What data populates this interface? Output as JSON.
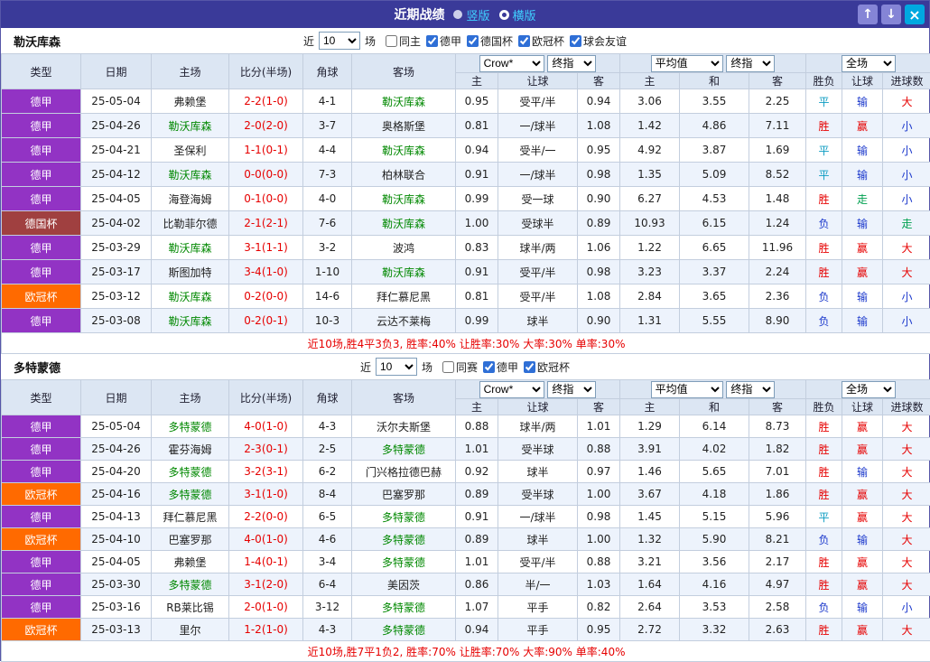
{
  "titlebar": {
    "title": "近期战绩",
    "radios": [
      {
        "label": "竖版",
        "selected": false
      },
      {
        "label": "横版",
        "selected": true
      }
    ],
    "up_glyph": "↑",
    "down_glyph": "↓",
    "close_glyph": "×",
    "bg": "#3a3a99"
  },
  "filter_labels": {
    "near": "近",
    "games": "场"
  },
  "columns": {
    "left": [
      "类型",
      "日期",
      "主场",
      "比分(半场)",
      "角球",
      "客场"
    ],
    "sub": [
      "主",
      "让球",
      "客",
      "主",
      "和",
      "客",
      "胜负",
      "让球",
      "进球数"
    ]
  },
  "league_colors": {
    "德甲": "#9233c4",
    "德国杯": "#a04040",
    "欧冠杯": "#ff6a00"
  },
  "result_colors": {
    "胜": "#e60000",
    "赢": "#e60000",
    "大": "#e60000",
    "负": "#1c39cc",
    "输": "#1c39cc",
    "小": "#1c39cc",
    "平": "#0d9cc2",
    "走": "#00a050"
  },
  "team_color": "#008800",
  "score_color": "#e60000",
  "sections": [
    {
      "team": "勒沃库森",
      "filter": {
        "count": "10",
        "checkboxes": [
          {
            "label": "同主",
            "checked": false
          },
          {
            "label": "德甲",
            "checked": true
          },
          {
            "label": "德国杯",
            "checked": true
          },
          {
            "label": "欧冠杯",
            "checked": true
          },
          {
            "label": "球会友谊",
            "checked": true
          }
        ]
      },
      "selects": {
        "odds_company": "Crow*",
        "odds_time": "终指",
        "avg": "平均值",
        "avg_time": "终指",
        "scope": "全场"
      },
      "rows": [
        {
          "league": "德甲",
          "date": "25-05-04",
          "home": "弗赖堡",
          "homeTeam": false,
          "score": "2-2(1-0)",
          "corner": "4-1",
          "away": "勒沃库森",
          "awayTeam": true,
          "odds": [
            "0.95",
            "受平/半",
            "0.94"
          ],
          "euro": [
            "3.06",
            "3.55",
            "2.25"
          ],
          "res": [
            "平",
            "输",
            "大"
          ]
        },
        {
          "league": "德甲",
          "date": "25-04-26",
          "home": "勒沃库森",
          "homeTeam": true,
          "score": "2-0(2-0)",
          "corner": "3-7",
          "away": "奥格斯堡",
          "awayTeam": false,
          "odds": [
            "0.81",
            "一/球半",
            "1.08"
          ],
          "euro": [
            "1.42",
            "4.86",
            "7.11"
          ],
          "res": [
            "胜",
            "赢",
            "小"
          ]
        },
        {
          "league": "德甲",
          "date": "25-04-21",
          "home": "圣保利",
          "homeTeam": false,
          "score": "1-1(0-1)",
          "corner": "4-4",
          "away": "勒沃库森",
          "awayTeam": true,
          "odds": [
            "0.94",
            "受半/一",
            "0.95"
          ],
          "euro": [
            "4.92",
            "3.87",
            "1.69"
          ],
          "res": [
            "平",
            "输",
            "小"
          ]
        },
        {
          "league": "德甲",
          "date": "25-04-12",
          "home": "勒沃库森",
          "homeTeam": true,
          "score": "0-0(0-0)",
          "corner": "7-3",
          "away": "柏林联合",
          "awayTeam": false,
          "odds": [
            "0.91",
            "一/球半",
            "0.98"
          ],
          "euro": [
            "1.35",
            "5.09",
            "8.52"
          ],
          "res": [
            "平",
            "输",
            "小"
          ]
        },
        {
          "league": "德甲",
          "date": "25-04-05",
          "home": "海登海姆",
          "homeTeam": false,
          "score": "0-1(0-0)",
          "corner": "4-0",
          "away": "勒沃库森",
          "awayTeam": true,
          "odds": [
            "0.99",
            "受一球",
            "0.90"
          ],
          "euro": [
            "6.27",
            "4.53",
            "1.48"
          ],
          "res": [
            "胜",
            "走",
            "小"
          ]
        },
        {
          "league": "德国杯",
          "date": "25-04-02",
          "home": "比勒菲尔德",
          "homeTeam": false,
          "score": "2-1(2-1)",
          "corner": "7-6",
          "away": "勒沃库森",
          "awayTeam": true,
          "odds": [
            "1.00",
            "受球半",
            "0.89"
          ],
          "euro": [
            "10.93",
            "6.15",
            "1.24"
          ],
          "res": [
            "负",
            "输",
            "走"
          ]
        },
        {
          "league": "德甲",
          "date": "25-03-29",
          "home": "勒沃库森",
          "homeTeam": true,
          "score": "3-1(1-1)",
          "corner": "3-2",
          "away": "波鸿",
          "awayTeam": false,
          "odds": [
            "0.83",
            "球半/两",
            "1.06"
          ],
          "euro": [
            "1.22",
            "6.65",
            "11.96"
          ],
          "res": [
            "胜",
            "赢",
            "大"
          ]
        },
        {
          "league": "德甲",
          "date": "25-03-17",
          "home": "斯图加特",
          "homeTeam": false,
          "score": "3-4(1-0)",
          "corner": "1-10",
          "away": "勒沃库森",
          "awayTeam": true,
          "odds": [
            "0.91",
            "受平/半",
            "0.98"
          ],
          "euro": [
            "3.23",
            "3.37",
            "2.24"
          ],
          "res": [
            "胜",
            "赢",
            "大"
          ]
        },
        {
          "league": "欧冠杯",
          "date": "25-03-12",
          "home": "勒沃库森",
          "homeTeam": true,
          "score": "0-2(0-0)",
          "corner": "14-6",
          "away": "拜仁慕尼黑",
          "awayTeam": false,
          "odds": [
            "0.81",
            "受平/半",
            "1.08"
          ],
          "euro": [
            "2.84",
            "3.65",
            "2.36"
          ],
          "res": [
            "负",
            "输",
            "小"
          ]
        },
        {
          "league": "德甲",
          "date": "25-03-08",
          "home": "勒沃库森",
          "homeTeam": true,
          "score": "0-2(0-1)",
          "corner": "10-3",
          "away": "云达不莱梅",
          "awayTeam": false,
          "odds": [
            "0.99",
            "球半",
            "0.90"
          ],
          "euro": [
            "1.31",
            "5.55",
            "8.90"
          ],
          "res": [
            "负",
            "输",
            "小"
          ]
        }
      ],
      "summary": "近10场,胜4平3负3, 胜率:40% 让胜率:30% 大率:30% 单率:30%"
    },
    {
      "team": "多特蒙德",
      "filter": {
        "count": "10",
        "checkboxes": [
          {
            "label": "同赛",
            "checked": false
          },
          {
            "label": "德甲",
            "checked": true
          },
          {
            "label": "欧冠杯",
            "checked": true
          }
        ]
      },
      "selects": {
        "odds_company": "Crow*",
        "odds_time": "终指",
        "avg": "平均值",
        "avg_time": "终指",
        "scope": "全场"
      },
      "rows": [
        {
          "league": "德甲",
          "date": "25-05-04",
          "home": "多特蒙德",
          "homeTeam": true,
          "score": "4-0(1-0)",
          "corner": "4-3",
          "away": "沃尔夫斯堡",
          "awayTeam": false,
          "odds": [
            "0.88",
            "球半/两",
            "1.01"
          ],
          "euro": [
            "1.29",
            "6.14",
            "8.73"
          ],
          "res": [
            "胜",
            "赢",
            "大"
          ]
        },
        {
          "league": "德甲",
          "date": "25-04-26",
          "home": "霍芬海姆",
          "homeTeam": false,
          "score": "2-3(0-1)",
          "corner": "2-5",
          "away": "多特蒙德",
          "awayTeam": true,
          "odds": [
            "1.01",
            "受半球",
            "0.88"
          ],
          "euro": [
            "3.91",
            "4.02",
            "1.82"
          ],
          "res": [
            "胜",
            "赢",
            "大"
          ]
        },
        {
          "league": "德甲",
          "date": "25-04-20",
          "home": "多特蒙德",
          "homeTeam": true,
          "score": "3-2(3-1)",
          "corner": "6-2",
          "away": "门兴格拉德巴赫",
          "awayTeam": false,
          "odds": [
            "0.92",
            "球半",
            "0.97"
          ],
          "euro": [
            "1.46",
            "5.65",
            "7.01"
          ],
          "res": [
            "胜",
            "输",
            "大"
          ]
        },
        {
          "league": "欧冠杯",
          "date": "25-04-16",
          "home": "多特蒙德",
          "homeTeam": true,
          "score": "3-1(1-0)",
          "corner": "8-4",
          "away": "巴塞罗那",
          "awayTeam": false,
          "odds": [
            "0.89",
            "受半球",
            "1.00"
          ],
          "euro": [
            "3.67",
            "4.18",
            "1.86"
          ],
          "res": [
            "胜",
            "赢",
            "大"
          ]
        },
        {
          "league": "德甲",
          "date": "25-04-13",
          "home": "拜仁慕尼黑",
          "homeTeam": false,
          "score": "2-2(0-0)",
          "corner": "6-5",
          "away": "多特蒙德",
          "awayTeam": true,
          "odds": [
            "0.91",
            "一/球半",
            "0.98"
          ],
          "euro": [
            "1.45",
            "5.15",
            "5.96"
          ],
          "res": [
            "平",
            "赢",
            "大"
          ]
        },
        {
          "league": "欧冠杯",
          "date": "25-04-10",
          "home": "巴塞罗那",
          "homeTeam": false,
          "score": "4-0(1-0)",
          "corner": "4-6",
          "away": "多特蒙德",
          "awayTeam": true,
          "odds": [
            "0.89",
            "球半",
            "1.00"
          ],
          "euro": [
            "1.32",
            "5.90",
            "8.21"
          ],
          "res": [
            "负",
            "输",
            "大"
          ]
        },
        {
          "league": "德甲",
          "date": "25-04-05",
          "home": "弗赖堡",
          "homeTeam": false,
          "score": "1-4(0-1)",
          "corner": "3-4",
          "away": "多特蒙德",
          "awayTeam": true,
          "odds": [
            "1.01",
            "受平/半",
            "0.88"
          ],
          "euro": [
            "3.21",
            "3.56",
            "2.17"
          ],
          "res": [
            "胜",
            "赢",
            "大"
          ]
        },
        {
          "league": "德甲",
          "date": "25-03-30",
          "home": "多特蒙德",
          "homeTeam": true,
          "score": "3-1(2-0)",
          "corner": "6-4",
          "away": "美因茨",
          "awayTeam": false,
          "odds": [
            "0.86",
            "半/一",
            "1.03"
          ],
          "euro": [
            "1.64",
            "4.16",
            "4.97"
          ],
          "res": [
            "胜",
            "赢",
            "大"
          ]
        },
        {
          "league": "德甲",
          "date": "25-03-16",
          "home": "RB莱比锡",
          "homeTeam": false,
          "score": "2-0(1-0)",
          "corner": "3-12",
          "away": "多特蒙德",
          "awayTeam": true,
          "odds": [
            "1.07",
            "平手",
            "0.82"
          ],
          "euro": [
            "2.64",
            "3.53",
            "2.58"
          ],
          "res": [
            "负",
            "输",
            "小"
          ]
        },
        {
          "league": "欧冠杯",
          "date": "25-03-13",
          "home": "里尔",
          "homeTeam": false,
          "score": "1-2(1-0)",
          "corner": "4-3",
          "away": "多特蒙德",
          "awayTeam": true,
          "odds": [
            "0.94",
            "平手",
            "0.95"
          ],
          "euro": [
            "2.72",
            "3.32",
            "2.63"
          ],
          "res": [
            "胜",
            "赢",
            "大"
          ]
        }
      ],
      "summary": "近10场,胜7平1负2, 胜率:70% 让胜率:70% 大率:90% 单率:40%"
    }
  ]
}
